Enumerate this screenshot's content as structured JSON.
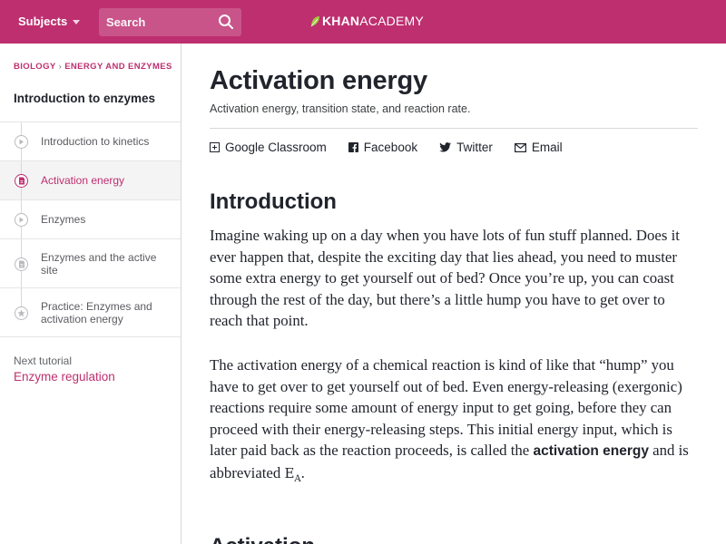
{
  "header": {
    "subjects_label": "Subjects",
    "search_placeholder": "Search",
    "logo_strong": "KHAN",
    "logo_light": "ACADEMY",
    "brand_color": "#be2f6f"
  },
  "sidebar": {
    "breadcrumb": [
      "BIOLOGY",
      "ENERGY AND ENZYMES"
    ],
    "tutorial_title": "Introduction to enzymes",
    "items": [
      {
        "label": "Introduction to kinetics",
        "icon": "video-play-icon",
        "active": false
      },
      {
        "label": "Activation energy",
        "icon": "article-icon",
        "active": true
      },
      {
        "label": "Enzymes",
        "icon": "video-play-icon",
        "active": false
      },
      {
        "label": "Enzymes and the active site",
        "icon": "article-icon",
        "active": false
      },
      {
        "label": "Practice: Enzymes and activation energy",
        "icon": "star-icon",
        "active": false
      }
    ],
    "next_label": "Next tutorial",
    "next_link": "Enzyme regulation"
  },
  "main": {
    "title": "Activation energy",
    "description": "Activation energy, transition state, and reaction rate.",
    "share": {
      "google_classroom": "Google Classroom",
      "facebook": "Facebook",
      "twitter": "Twitter",
      "email": "Email"
    },
    "section_heading": "Introduction",
    "paragraph1": "Imagine waking up on a day when you have lots of fun stuff planned. Does it ever happen that, despite the exciting day that lies ahead, you need to muster some extra energy to get yourself out of bed? Once you’re up, you can coast through the rest of the day, but there’s a little hump you have to get over to reach that point.",
    "paragraph2_start": "The activation energy of a chemical reaction is kind of like that “hump” you have to get over to get yourself out of bed. Even energy-releasing (exergonic) reactions require some amount of energy input to get going, before they can proceed with their energy-releasing steps. This initial energy input, which is later paid back as the reaction proceeds, is called the ",
    "paragraph2_bold": "activation energy",
    "paragraph2_mid": " and is abbreviated ",
    "math_E": "E",
    "math_sub": "A",
    "paragraph2_end": ".",
    "next_heading": "Activation"
  }
}
